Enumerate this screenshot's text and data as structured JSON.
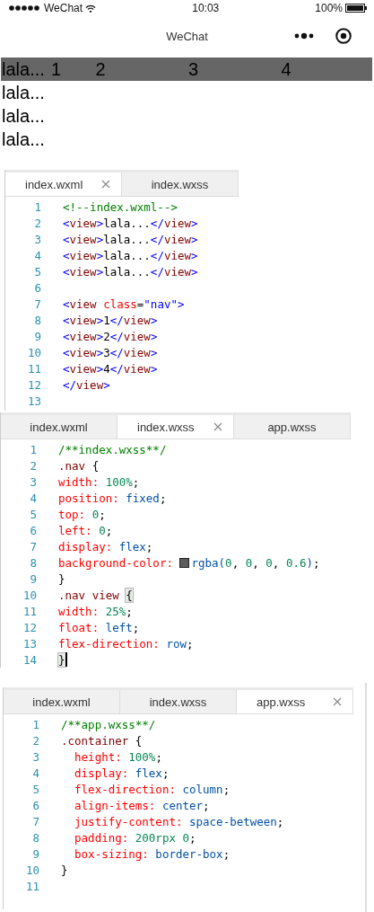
{
  "status_bar": {
    "carrier": "WeChat",
    "time": "10:03",
    "battery": "100%"
  },
  "nav_bar": {
    "title": "WeChat"
  },
  "preview": {
    "nav_items": [
      "1",
      "2",
      "3",
      "4"
    ],
    "lines": [
      "lala...",
      "lala...",
      "lala...",
      "lala..."
    ]
  },
  "editors": [
    {
      "tabs": [
        {
          "label": "index.wxml",
          "selected": true
        },
        {
          "label": "index.wxss",
          "selected": false
        }
      ],
      "lines": [
        {
          "number": "1",
          "tokens": [
            {
              "kind": "comment",
              "text": "<!--index.wxml-->"
            }
          ]
        },
        {
          "number": "2",
          "tokens": [
            {
              "kind": "punct",
              "text": "<"
            },
            {
              "kind": "tag",
              "text": "view"
            },
            {
              "kind": "punct",
              "text": ">"
            },
            {
              "kind": "text",
              "text": "lala..."
            },
            {
              "kind": "punct",
              "text": "</"
            },
            {
              "kind": "tag",
              "text": "view"
            },
            {
              "kind": "punct",
              "text": ">"
            }
          ]
        },
        {
          "number": "3",
          "tokens": [
            {
              "kind": "punct",
              "text": "<"
            },
            {
              "kind": "tag",
              "text": "view"
            },
            {
              "kind": "punct",
              "text": ">"
            },
            {
              "kind": "text",
              "text": "lala..."
            },
            {
              "kind": "punct",
              "text": "</"
            },
            {
              "kind": "tag",
              "text": "view"
            },
            {
              "kind": "punct",
              "text": ">"
            }
          ]
        },
        {
          "number": "4",
          "tokens": [
            {
              "kind": "punct",
              "text": "<"
            },
            {
              "kind": "tag",
              "text": "view"
            },
            {
              "kind": "punct",
              "text": ">"
            },
            {
              "kind": "text",
              "text": "lala..."
            },
            {
              "kind": "punct",
              "text": "</"
            },
            {
              "kind": "tag",
              "text": "view"
            },
            {
              "kind": "punct",
              "text": ">"
            }
          ]
        },
        {
          "number": "5",
          "tokens": [
            {
              "kind": "punct",
              "text": "<"
            },
            {
              "kind": "tag",
              "text": "view"
            },
            {
              "kind": "punct",
              "text": ">"
            },
            {
              "kind": "text",
              "text": "lala..."
            },
            {
              "kind": "punct",
              "text": "</"
            },
            {
              "kind": "tag",
              "text": "view"
            },
            {
              "kind": "punct",
              "text": ">"
            }
          ]
        },
        {
          "number": "6"
        },
        {
          "number": "7",
          "tokens": [
            {
              "kind": "punct",
              "text": "<"
            },
            {
              "kind": "tag",
              "text": "view "
            },
            {
              "kind": "attr",
              "text": "class"
            },
            {
              "kind": "text",
              "text": "="
            },
            {
              "kind": "string",
              "text": "\"nav\""
            },
            {
              "kind": "punct",
              "text": ">"
            }
          ]
        },
        {
          "number": "8",
          "tokens": [
            {
              "kind": "punct",
              "text": "<"
            },
            {
              "kind": "tag",
              "text": "view"
            },
            {
              "kind": "punct",
              "text": ">"
            },
            {
              "kind": "text",
              "text": "1"
            },
            {
              "kind": "punct",
              "text": "</"
            },
            {
              "kind": "tag",
              "text": "view"
            },
            {
              "kind": "punct",
              "text": ">"
            }
          ]
        },
        {
          "number": "9",
          "tokens": [
            {
              "kind": "punct",
              "text": "<"
            },
            {
              "kind": "tag",
              "text": "view"
            },
            {
              "kind": "punct",
              "text": ">"
            },
            {
              "kind": "text",
              "text": "2"
            },
            {
              "kind": "punct",
              "text": "</"
            },
            {
              "kind": "tag",
              "text": "view"
            },
            {
              "kind": "punct",
              "text": ">"
            }
          ]
        },
        {
          "number": "10",
          "tokens": [
            {
              "kind": "punct",
              "text": "<"
            },
            {
              "kind": "tag",
              "text": "view"
            },
            {
              "kind": "punct",
              "text": ">"
            },
            {
              "kind": "text",
              "text": "3"
            },
            {
              "kind": "punct",
              "text": "</"
            },
            {
              "kind": "tag",
              "text": "view"
            },
            {
              "kind": "punct",
              "text": ">"
            }
          ]
        },
        {
          "number": "11",
          "tokens": [
            {
              "kind": "punct",
              "text": "<"
            },
            {
              "kind": "tag",
              "text": "view"
            },
            {
              "kind": "punct",
              "text": ">"
            },
            {
              "kind": "text",
              "text": "4"
            },
            {
              "kind": "punct",
              "text": "</"
            },
            {
              "kind": "tag",
              "text": "view"
            },
            {
              "kind": "punct",
              "text": ">"
            }
          ]
        },
        {
          "number": "12",
          "tokens": [
            {
              "kind": "punct",
              "text": "</"
            },
            {
              "kind": "tag",
              "text": "view"
            },
            {
              "kind": "punct",
              "text": ">"
            }
          ]
        },
        {
          "number": "13"
        }
      ]
    },
    {
      "tabs": [
        {
          "label": "index.wxml",
          "selected": false
        },
        {
          "label": "index.wxss",
          "selected": true
        },
        {
          "label": "app.wxss",
          "selected": false
        }
      ],
      "lines": [
        {
          "number": "1",
          "tokens": [
            {
              "kind": "comment",
              "text": "/**index.wxss**/"
            }
          ]
        },
        {
          "number": "2",
          "tokens": [
            {
              "kind": "tag",
              "text": ".nav"
            },
            {
              "kind": "text",
              "text": " {"
            }
          ]
        },
        {
          "number": "3",
          "tokens": [
            {
              "kind": "prop",
              "text": "width: "
            },
            {
              "kind": "number",
              "text": "100%"
            },
            {
              "kind": "text",
              "text": ";"
            }
          ]
        },
        {
          "number": "4",
          "tokens": [
            {
              "kind": "prop",
              "text": "position: "
            },
            {
              "kind": "value",
              "text": "fixed"
            },
            {
              "kind": "text",
              "text": ";"
            }
          ]
        },
        {
          "number": "5",
          "tokens": [
            {
              "kind": "prop",
              "text": "top: "
            },
            {
              "kind": "number",
              "text": "0"
            },
            {
              "kind": "text",
              "text": ";"
            }
          ]
        },
        {
          "number": "6",
          "tokens": [
            {
              "kind": "prop",
              "text": "left: "
            },
            {
              "kind": "number",
              "text": "0"
            },
            {
              "kind": "text",
              "text": ";"
            }
          ]
        },
        {
          "number": "7",
          "tokens": [
            {
              "kind": "prop",
              "text": "display: "
            },
            {
              "kind": "value",
              "text": "flex"
            },
            {
              "kind": "text",
              "text": ";"
            }
          ]
        },
        {
          "number": "8",
          "tokens": [
            {
              "kind": "prop",
              "text": "background-color: "
            },
            {
              "kind": "swatch",
              "color": "#5c5c5c"
            },
            {
              "kind": "value",
              "text": "rgba("
            },
            {
              "kind": "number",
              "text": "0"
            },
            {
              "kind": "text",
              "text": ", "
            },
            {
              "kind": "number",
              "text": "0"
            },
            {
              "kind": "text",
              "text": ", "
            },
            {
              "kind": "number",
              "text": "0"
            },
            {
              "kind": "text",
              "text": ", "
            },
            {
              "kind": "number",
              "text": "0.6"
            },
            {
              "kind": "value",
              "text": ")"
            },
            {
              "kind": "text",
              "text": ";"
            }
          ]
        },
        {
          "number": "9",
          "tokens": [
            {
              "kind": "text",
              "text": "}"
            }
          ]
        },
        {
          "number": "10",
          "tokens": [
            {
              "kind": "tag",
              "text": ".nav view "
            },
            {
              "kind": "match",
              "text": "{"
            }
          ]
        },
        {
          "number": "11",
          "tokens": [
            {
              "kind": "prop",
              "text": "width: "
            },
            {
              "kind": "number",
              "text": "25%"
            },
            {
              "kind": "text",
              "text": ";"
            }
          ]
        },
        {
          "number": "12",
          "tokens": [
            {
              "kind": "prop",
              "text": "float: "
            },
            {
              "kind": "value",
              "text": "left"
            },
            {
              "kind": "text",
              "text": ";"
            }
          ]
        },
        {
          "number": "13",
          "tokens": [
            {
              "kind": "prop",
              "text": "flex-direction: "
            },
            {
              "kind": "value",
              "text": "row"
            },
            {
              "kind": "text",
              "text": ";"
            }
          ]
        },
        {
          "number": "14",
          "tokens": [
            {
              "kind": "match",
              "text": "}"
            },
            {
              "kind": "cursor"
            }
          ]
        }
      ]
    },
    {
      "tabs": [
        {
          "label": "index.wxml",
          "selected": false
        },
        {
          "label": "index.wxss",
          "selected": false
        },
        {
          "label": "app.wxss",
          "selected": true
        }
      ],
      "lines": [
        {
          "number": "1",
          "tokens": [
            {
              "kind": "comment",
              "text": "/**app.wxss**/"
            }
          ]
        },
        {
          "number": "2",
          "tokens": [
            {
              "kind": "tag",
              "text": ".container"
            },
            {
              "kind": "text",
              "text": " {"
            }
          ]
        },
        {
          "number": "3",
          "tokens": [
            {
              "kind": "prop",
              "text": "  height: "
            },
            {
              "kind": "number",
              "text": "100%"
            },
            {
              "kind": "text",
              "text": ";"
            }
          ]
        },
        {
          "number": "4",
          "tokens": [
            {
              "kind": "prop",
              "text": "  display: "
            },
            {
              "kind": "value",
              "text": "flex"
            },
            {
              "kind": "text",
              "text": ";"
            }
          ]
        },
        {
          "number": "5",
          "tokens": [
            {
              "kind": "prop",
              "text": "  flex-direction: "
            },
            {
              "kind": "value",
              "text": "column"
            },
            {
              "kind": "text",
              "text": ";"
            }
          ]
        },
        {
          "number": "6",
          "tokens": [
            {
              "kind": "prop",
              "text": "  align-items: "
            },
            {
              "kind": "value",
              "text": "center"
            },
            {
              "kind": "text",
              "text": ";"
            }
          ]
        },
        {
          "number": "7",
          "tokens": [
            {
              "kind": "prop",
              "text": "  justify-content: "
            },
            {
              "kind": "value",
              "text": "space-between"
            },
            {
              "kind": "text",
              "text": ";"
            }
          ]
        },
        {
          "number": "8",
          "tokens": [
            {
              "kind": "prop",
              "text": "  padding: "
            },
            {
              "kind": "number",
              "text": "200rpx 0"
            },
            {
              "kind": "text",
              "text": ";"
            }
          ]
        },
        {
          "number": "9",
          "tokens": [
            {
              "kind": "prop",
              "text": "  box-sizing: "
            },
            {
              "kind": "value",
              "text": "border-box"
            },
            {
              "kind": "text",
              "text": ";"
            }
          ]
        },
        {
          "number": "10",
          "tokens": [
            {
              "kind": "text",
              "text": "}"
            }
          ]
        },
        {
          "number": "11"
        }
      ]
    }
  ]
}
